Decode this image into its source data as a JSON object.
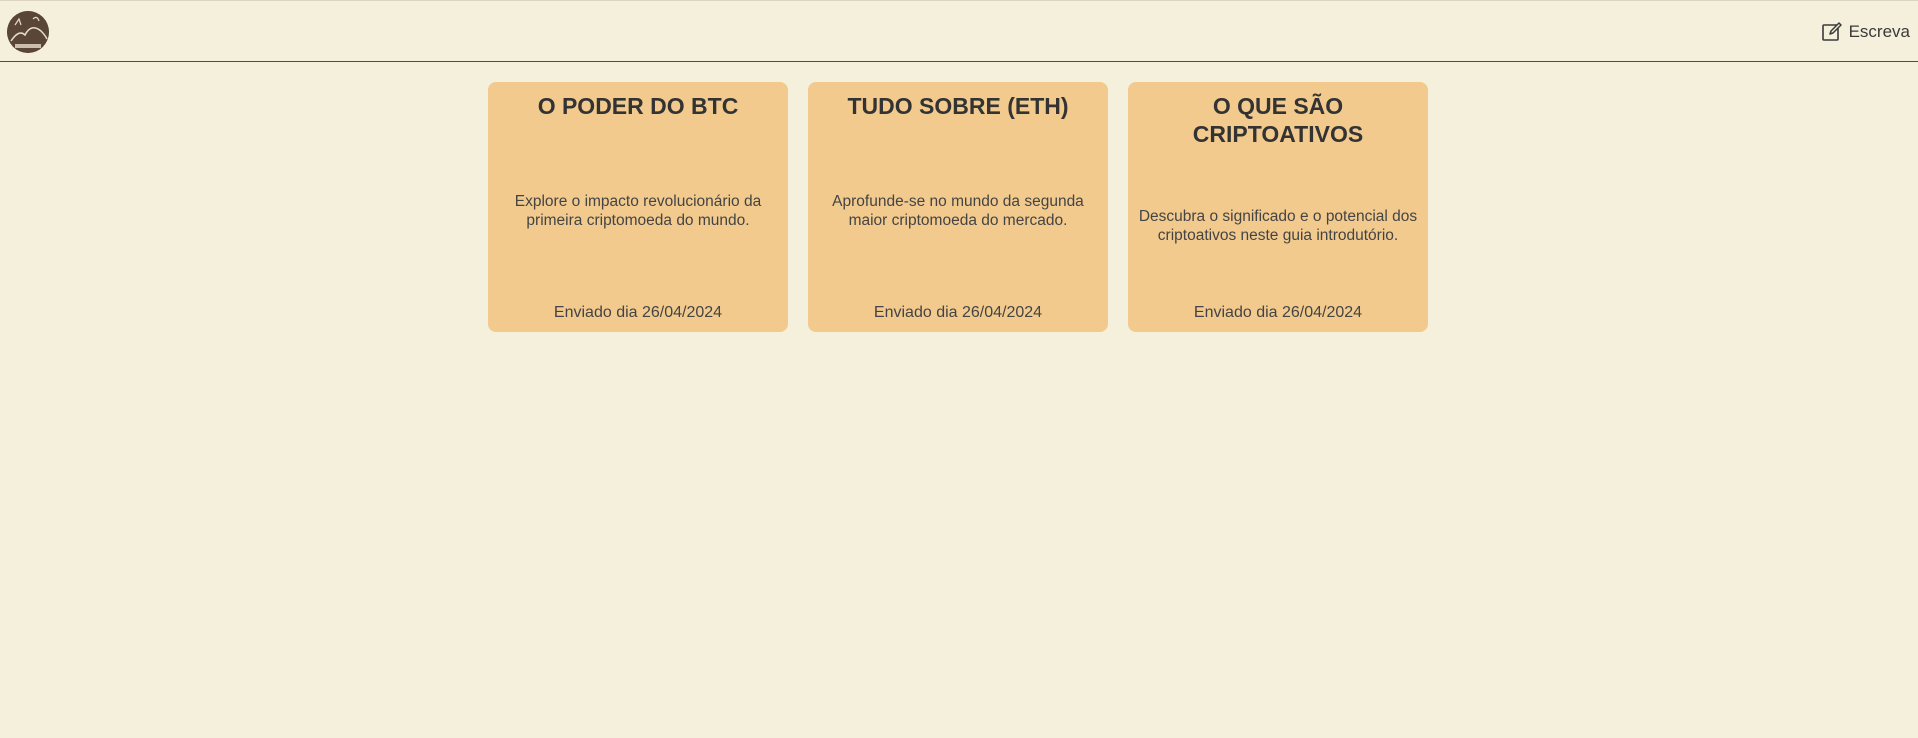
{
  "header": {
    "logo_icon": "logo-icon",
    "write_label": "Escreva",
    "write_icon": "edit-icon"
  },
  "cards": [
    {
      "title": "O PODER DO BTC",
      "description": "Explore o impacto revolucionário da primeira criptomoeda do mundo.",
      "date": "Enviado dia 26/04/2024"
    },
    {
      "title": "TUDO SOBRE (ETH)",
      "description": "Aprofunde-se no mundo da segunda maior criptomoeda do mercado.",
      "date": "Enviado dia 26/04/2024"
    },
    {
      "title": "O QUE SÃO CRIPTOATIVOS",
      "description": "Descubra o significado e o potencial dos criptoativos neste guia introdutório.",
      "date": "Enviado dia 26/04/2024"
    }
  ],
  "colors": {
    "background": "#f5f0dc",
    "card": "#f2ca8e",
    "text": "#333333"
  }
}
